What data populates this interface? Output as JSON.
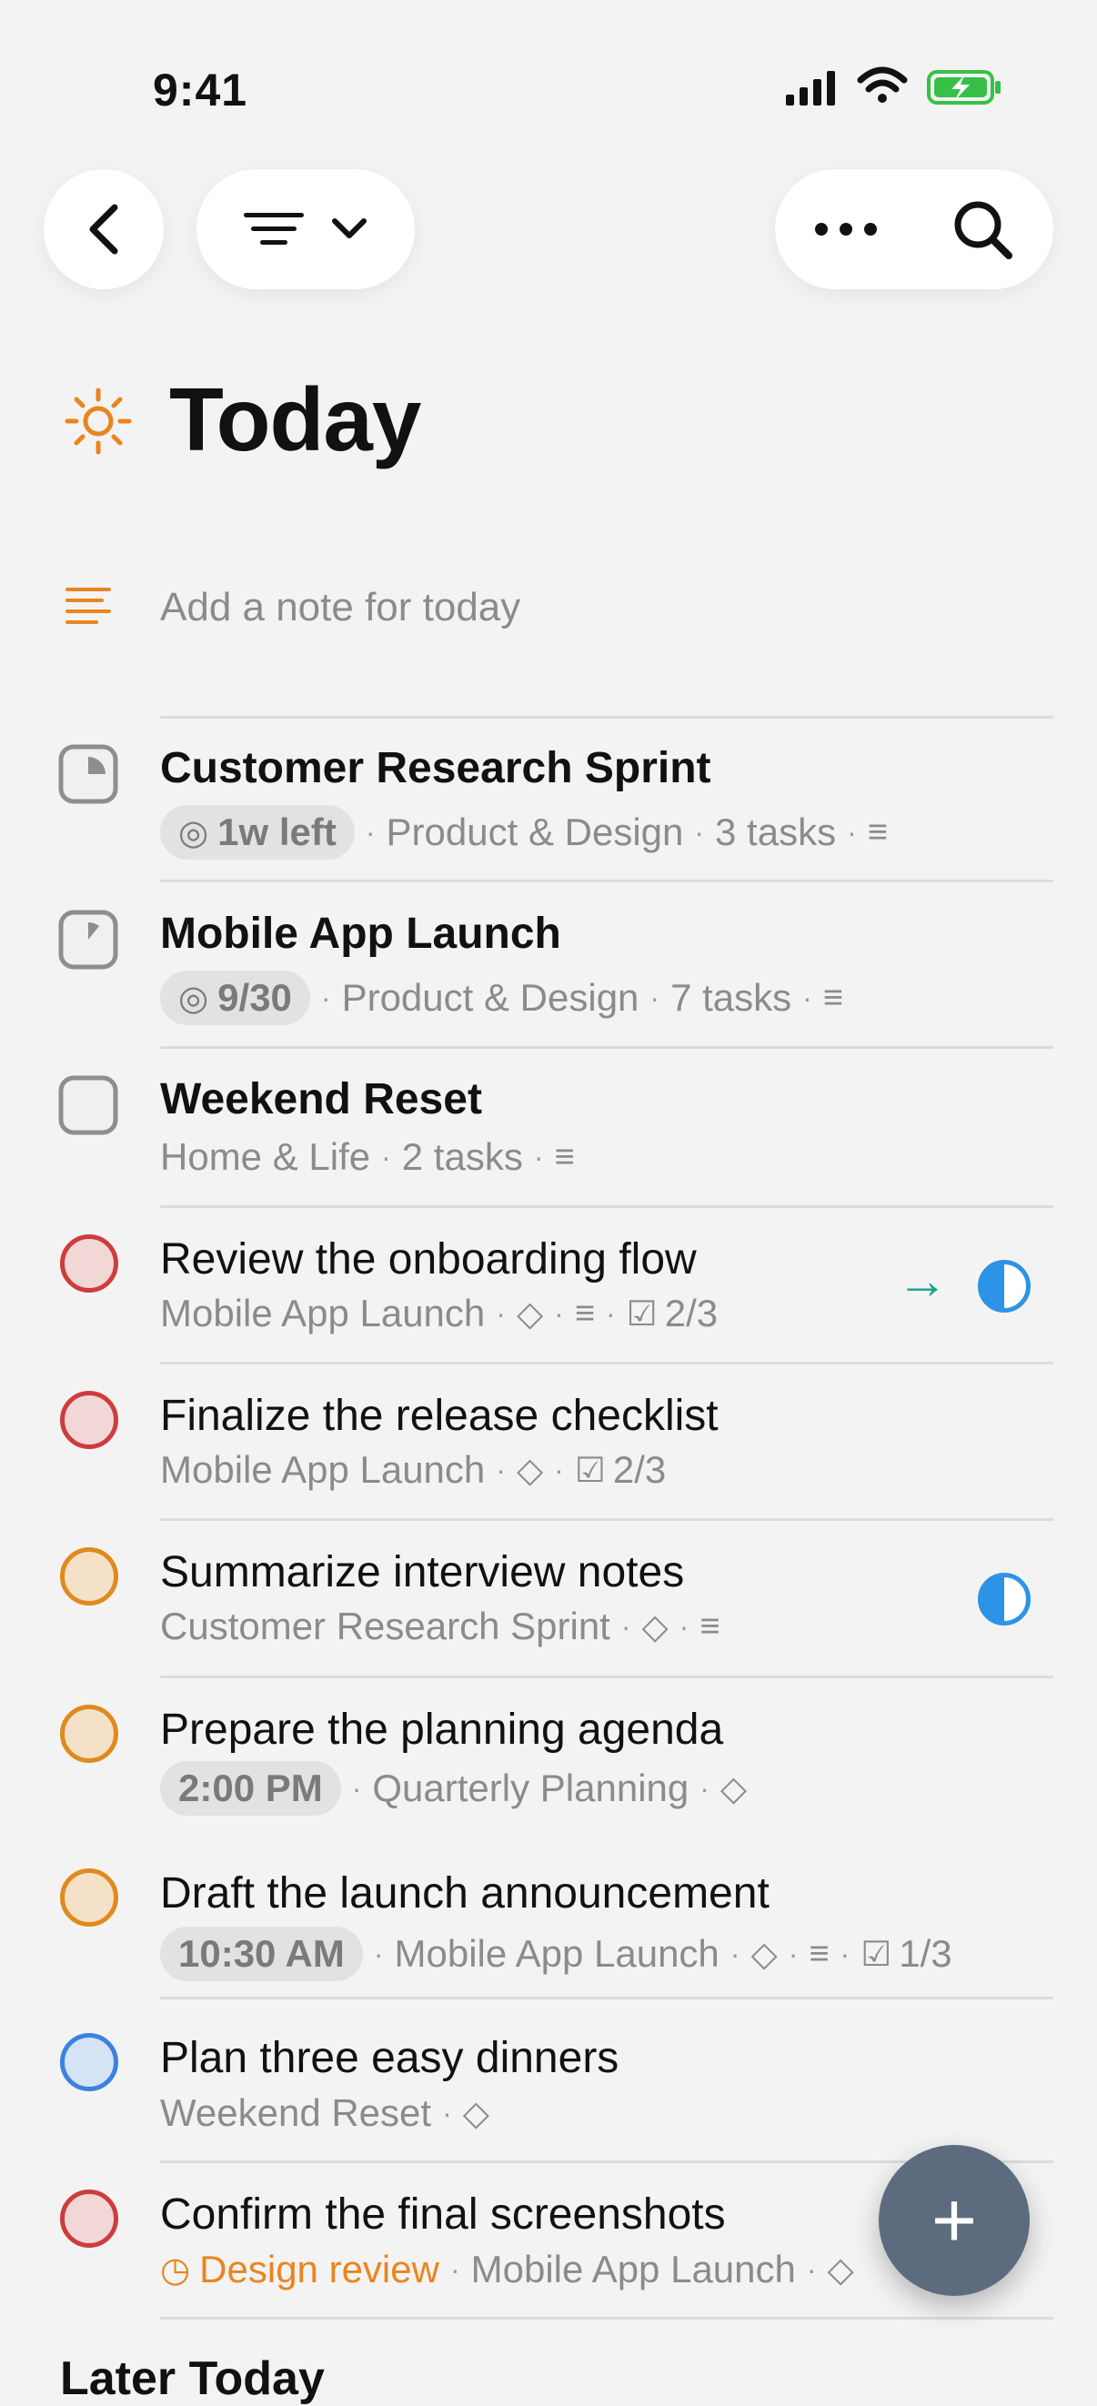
{
  "status": {
    "time": "9:41"
  },
  "toolbar": {
    "back_icon": "chevron-left-icon",
    "filter_icon": "filter-lines-icon",
    "filter_chevron": "chevron-down-icon",
    "more_icon": "ellipsis-icon",
    "search_icon": "search-icon"
  },
  "header": {
    "title": "Today",
    "icon": "sun-icon"
  },
  "note": {
    "placeholder": "Add a note for today"
  },
  "projects": [
    {
      "title": "Customer Research Sprint",
      "chip": "1w left",
      "area": "Product & Design",
      "count": "3 tasks"
    },
    {
      "title": "Mobile App Launch",
      "chip": "9/30",
      "area": "Product & Design",
      "count": "7 tasks"
    },
    {
      "title": "Weekend Reset",
      "area": "Home & Life",
      "count": "2 tasks"
    }
  ],
  "tasks": [
    {
      "title": "Review the onboarding flow",
      "project": "Mobile App Launch",
      "checklist": "2/3",
      "priority": "red"
    },
    {
      "title": "Finalize the release checklist",
      "project": "Mobile App Launch",
      "checklist": "2/3",
      "priority": "red"
    },
    {
      "title": "Summarize interview notes",
      "project": "Customer Research Sprint",
      "priority": "orange"
    },
    {
      "title": "Prepare the planning agenda",
      "time": "2:00 PM",
      "project": "Quarterly Planning",
      "priority": "orange"
    },
    {
      "title": "Draft the launch announcement",
      "time": "10:30 AM",
      "project": "Mobile App Launch",
      "checklist": "1/3",
      "priority": "orange"
    },
    {
      "title": "Plan three easy dinners",
      "project": "Weekend Reset",
      "priority": "blue"
    },
    {
      "title": "Confirm the final screenshots",
      "event": "Design review",
      "project": "Mobile App Launch",
      "priority": "red"
    }
  ],
  "sections": {
    "later_today": "Later Today"
  },
  "fab": {
    "label": "+"
  },
  "colors": {
    "accent": "#e9851f",
    "teal": "#16a38b",
    "blue": "#2d93e6",
    "fab": "#5d6b7e"
  }
}
